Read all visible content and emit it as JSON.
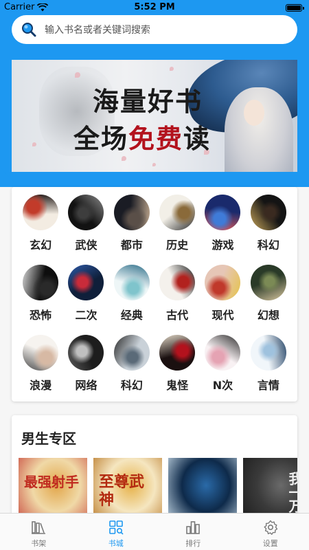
{
  "status": {
    "carrier": "Carrier",
    "time": "5:52 PM"
  },
  "search": {
    "placeholder": "输入书名或者关键词搜索"
  },
  "banner": {
    "line1": "海量好书",
    "line2a": "全场",
    "line2b": "免费",
    "line2c": "读"
  },
  "categories": [
    {
      "label": "玄幻",
      "colors": [
        "#f3ece2",
        "#c23b2a",
        "#2b2220"
      ]
    },
    {
      "label": "武侠",
      "colors": [
        "#121212",
        "#3d3d3d",
        "#8a8a8a"
      ]
    },
    {
      "label": "都市",
      "colors": [
        "#1a1c24",
        "#5a4f48",
        "#b9a28a"
      ]
    },
    {
      "label": "历史",
      "colors": [
        "#f2efe7",
        "#8a6a3a",
        "#2b2b2b"
      ]
    },
    {
      "label": "游戏",
      "colors": [
        "#1a2a6c",
        "#3f7bd8",
        "#e05a5a"
      ]
    },
    {
      "label": "科幻",
      "colors": [
        "#141414",
        "#3a2a20",
        "#c9a65a"
      ]
    },
    {
      "label": "恐怖",
      "colors": [
        "#0e0e0e",
        "#2a2a2a",
        "#d9d9d9"
      ]
    },
    {
      "label": "二次",
      "colors": [
        "#0f1f3a",
        "#c92b3a",
        "#2e5aa8"
      ]
    },
    {
      "label": "经典",
      "colors": [
        "#eef6f7",
        "#7fc4cc",
        "#2f6f8a"
      ]
    },
    {
      "label": "古代",
      "colors": [
        "#f4f1ec",
        "#b2221e",
        "#222222"
      ]
    },
    {
      "label": "现代",
      "colors": [
        "#e6c6b6",
        "#c0392b",
        "#e5c34a"
      ]
    },
    {
      "label": "幻想",
      "colors": [
        "#2a3a28",
        "#7b8a55",
        "#d9c7a0"
      ]
    },
    {
      "label": "浪漫",
      "colors": [
        "#f6f3ef",
        "#d7b9a4",
        "#4a4a4a"
      ]
    },
    {
      "label": "网络",
      "colors": [
        "#1d1d1d",
        "#bfbfbf",
        "#5a5a5a"
      ]
    },
    {
      "label": "科幻",
      "colors": [
        "#c9d1d8",
        "#5a6a78",
        "#2b2b2b"
      ]
    },
    {
      "label": "鬼怪",
      "colors": [
        "#1a1010",
        "#b3121d",
        "#e3d9c8"
      ]
    },
    {
      "label": "N次",
      "colors": [
        "#f8f1f3",
        "#e5a3b3",
        "#2b2b2b"
      ]
    },
    {
      "label": "言情",
      "colors": [
        "#f1f6fa",
        "#9fc2de",
        "#2b4a6b"
      ]
    }
  ],
  "male_section": {
    "title": "男生专区",
    "books": [
      {
        "title": "最强射手",
        "bg": [
          "#f0d9a7",
          "#e2a64a",
          "#c6423a"
        ],
        "ink": "#c02b20"
      },
      {
        "title": "至尊武神",
        "bg": [
          "#f5e6c0",
          "#e6b24a",
          "#b5711e"
        ],
        "ink": "#b32a10"
      },
      {
        "title": "",
        "bg": [
          "#0e2a4a",
          "#2a6aa8",
          "#d6e8f4"
        ],
        "ink": "#ffffff"
      },
      {
        "title": "我一万年",
        "bg": [
          "#3a3a3a",
          "#6a6a6a",
          "#1a1a1a"
        ],
        "ink": "#f1f1f1"
      }
    ]
  },
  "tabs": [
    {
      "label": "书架",
      "icon": "bookshelf-icon",
      "active": false
    },
    {
      "label": "书城",
      "icon": "bookstore-icon",
      "active": true
    },
    {
      "label": "排行",
      "icon": "ranking-icon",
      "active": false
    },
    {
      "label": "设置",
      "icon": "settings-icon",
      "active": false
    }
  ],
  "colors": {
    "accent": "#1d98f1",
    "tab_inactive": "#7a7a7a"
  }
}
